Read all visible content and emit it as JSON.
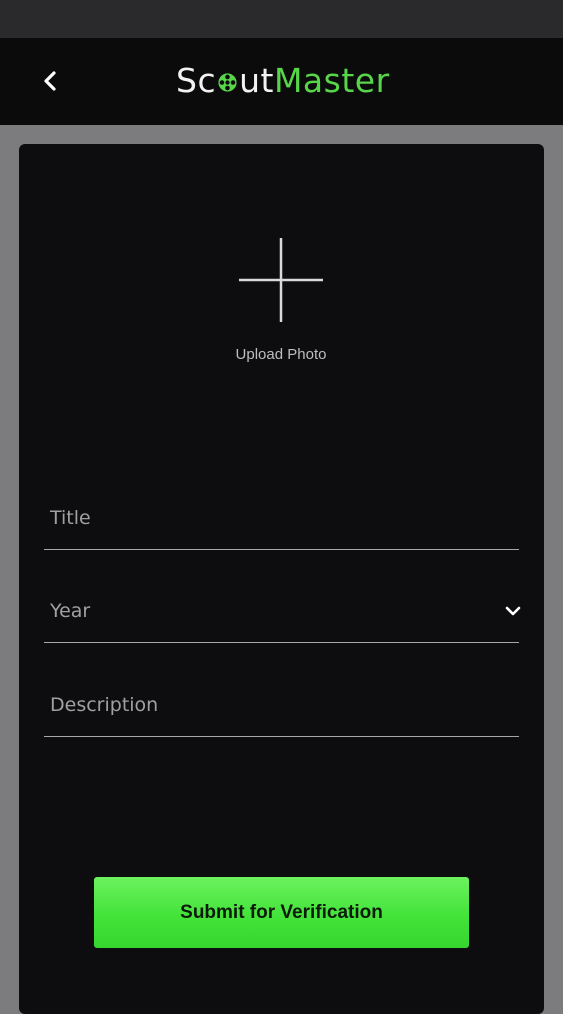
{
  "header": {
    "brand_scout_pre": "Sc",
    "brand_scout_post": "ut",
    "brand_master": "Master",
    "back_icon": "chevron-left-icon",
    "accent_color": "#58d64a"
  },
  "form": {
    "upload_label": "Upload Photo",
    "upload_icon": "plus-icon",
    "title_placeholder": "Title",
    "year_placeholder": "Year",
    "year_icon": "chevron-down-icon",
    "description_placeholder": "Description",
    "submit_label": "Submit for Verification"
  },
  "colors": {
    "background": "#7c7c7e",
    "card": "#0d0c0f",
    "header": "#0b0b0c",
    "button_green": "#43e33a"
  }
}
